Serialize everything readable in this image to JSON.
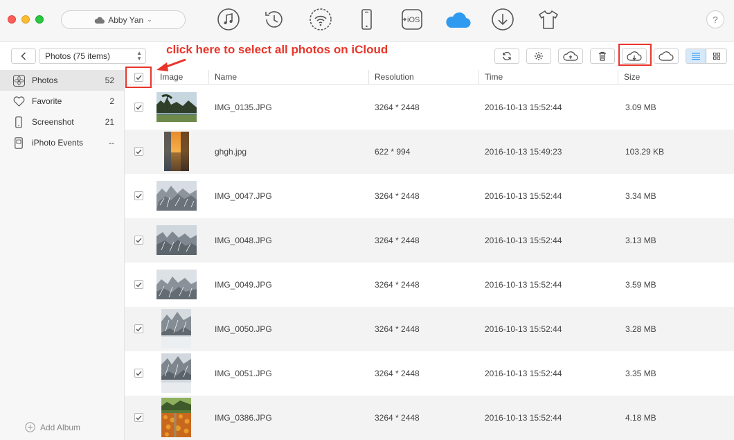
{
  "titlebar": {
    "device_name": "Abby Yan",
    "help_label": "?"
  },
  "topnav": {
    "icons": [
      "music-icon",
      "history-icon",
      "wifi-icon",
      "device-icon",
      "to-ios-icon",
      "icloud-icon",
      "download-icon",
      "tshirt-icon"
    ],
    "to_ios_label": "iOS"
  },
  "toolbar": {
    "album_select": "Photos (75 items)",
    "annotation": "click here to select all photos on iCloud",
    "buttons": [
      "refresh-icon",
      "settings-icon",
      "upload-to-cloud-icon",
      "delete-icon",
      "download-from-cloud-icon",
      "cloud-icon"
    ],
    "views": [
      "list-view-icon",
      "grid-view-icon"
    ]
  },
  "sidebar": {
    "items": [
      {
        "label": "Photos",
        "count": "52",
        "icon": "photos-icon"
      },
      {
        "label": "Favorite",
        "count": "2",
        "icon": "heart-icon"
      },
      {
        "label": "Screenshot",
        "count": "21",
        "icon": "phone-icon"
      },
      {
        "label": "iPhoto Events",
        "count": "--",
        "icon": "iphoto-icon"
      }
    ],
    "add_album": "Add Album"
  },
  "table": {
    "headers": {
      "image": "Image",
      "name": "Name",
      "resolution": "Resolution",
      "time": "Time",
      "size": "Size"
    },
    "select_all_checked": true,
    "rows": [
      {
        "name": "IMG_0135.JPG",
        "resolution": "3264 * 2448",
        "time": "2016-10-13 15:52:44",
        "size": "3.09 MB",
        "checked": true,
        "thumb": "lake-landscape"
      },
      {
        "name": "ghgh.jpg",
        "resolution": "622 * 994",
        "time": "2016-10-13 15:49:23",
        "size": "103.29 KB",
        "checked": true,
        "thumb": "sunset-portrait"
      },
      {
        "name": "IMG_0047.JPG",
        "resolution": "3264 * 2448",
        "time": "2016-10-13 15:52:44",
        "size": "3.34 MB",
        "checked": true,
        "thumb": "frosted-trees"
      },
      {
        "name": "IMG_0048.JPG",
        "resolution": "3264 * 2448",
        "time": "2016-10-13 15:52:44",
        "size": "3.13 MB",
        "checked": true,
        "thumb": "frosted-trees"
      },
      {
        "name": "IMG_0049.JPG",
        "resolution": "3264 * 2448",
        "time": "2016-10-13 15:52:44",
        "size": "3.59 MB",
        "checked": true,
        "thumb": "frosted-trees"
      },
      {
        "name": "IMG_0050.JPG",
        "resolution": "3264 * 2448",
        "time": "2016-10-13 15:52:44",
        "size": "3.28 MB",
        "checked": true,
        "thumb": "snowy-portrait"
      },
      {
        "name": "IMG_0051.JPG",
        "resolution": "3264 * 2448",
        "time": "2016-10-13 15:52:44",
        "size": "3.35 MB",
        "checked": true,
        "thumb": "snowy-portrait"
      },
      {
        "name": "IMG_0386.JPG",
        "resolution": "3264 * 2448",
        "time": "2016-10-13 15:52:44",
        "size": "4.18 MB",
        "checked": true,
        "thumb": "flower-garden"
      }
    ]
  },
  "colors": {
    "accent": "#1e8ff0",
    "annotation": "#e8352a",
    "icloud": "#2f9bf0"
  }
}
